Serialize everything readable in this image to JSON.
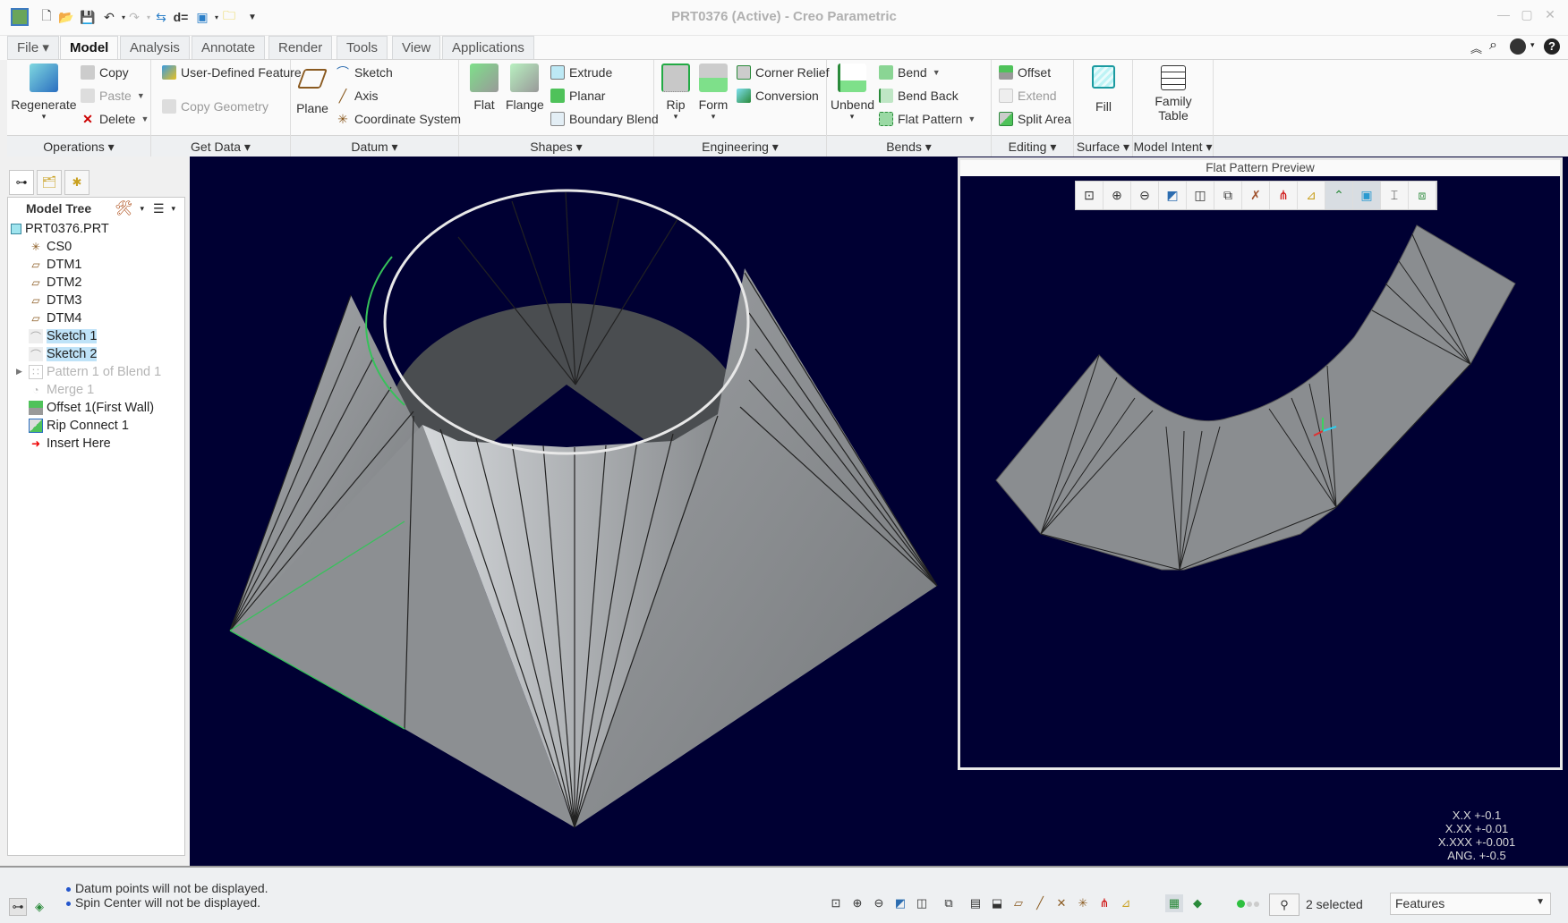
{
  "window": {
    "title": "PRT0376 (Active) - Creo Parametric",
    "minimize": "—",
    "maximize": "▢",
    "close": "✕"
  },
  "quick_access": [
    "app-icon",
    "new-icon",
    "open-icon",
    "save-icon",
    "undo-icon",
    "redo-icon",
    "regenerate-icon",
    "switch-dimensions-icon",
    "windows-icon",
    "close-icon",
    "customize-icon"
  ],
  "tabs": [
    {
      "label": "File ▾"
    },
    {
      "label": "Model"
    },
    {
      "label": "Analysis"
    },
    {
      "label": "Annotate"
    },
    {
      "label": "Render"
    },
    {
      "label": "Tools"
    },
    {
      "label": "View"
    },
    {
      "label": "Applications"
    }
  ],
  "ribbon": {
    "operations": {
      "label": "Operations",
      "regenerate": "Regenerate",
      "copy": "Copy",
      "paste": "Paste",
      "delete": "Delete"
    },
    "get_data": {
      "label": "Get Data",
      "udf": "User-Defined Feature",
      "copy_geometry": "Copy Geometry"
    },
    "datum": {
      "label": "Datum",
      "plane": "Plane",
      "sketch": "Sketch",
      "axis": "Axis",
      "csys": "Coordinate System"
    },
    "shapes": {
      "label": "Shapes",
      "flat": "Flat",
      "flange": "Flange",
      "extrude": "Extrude",
      "planar": "Planar",
      "boundary_blend": "Boundary Blend"
    },
    "engineering": {
      "label": "Engineering",
      "rip": "Rip",
      "form": "Form",
      "corner_relief": "Corner Relief",
      "conversion": "Conversion"
    },
    "bends": {
      "label": "Bends",
      "unbend": "Unbend",
      "bend": "Bend",
      "bend_back": "Bend Back",
      "flat_pattern": "Flat Pattern"
    },
    "editing": {
      "label": "Editing",
      "offset": "Offset",
      "extend": "Extend",
      "split_area": "Split Area"
    },
    "surface": {
      "label": "Surface",
      "fill": "Fill"
    },
    "model_intent": {
      "label": "Model Intent",
      "family_table_1": "Family",
      "family_table_2": "Table"
    }
  },
  "model_tree": {
    "header": "Model Tree",
    "items": [
      {
        "label": "PRT0376.PRT",
        "icon": "part-icon",
        "state": "normal"
      },
      {
        "label": "CS0",
        "icon": "csys-icon",
        "state": "normal"
      },
      {
        "label": "DTM1",
        "icon": "datum-plane-icon",
        "state": "normal"
      },
      {
        "label": "DTM2",
        "icon": "datum-plane-icon",
        "state": "normal"
      },
      {
        "label": "DTM3",
        "icon": "datum-plane-icon",
        "state": "normal"
      },
      {
        "label": "DTM4",
        "icon": "datum-plane-icon",
        "state": "normal"
      },
      {
        "label": "Sketch 1",
        "icon": "sketch-icon",
        "state": "selected"
      },
      {
        "label": "Sketch 2",
        "icon": "sketch-icon",
        "state": "selected"
      },
      {
        "label": "Pattern 1 of Blend 1",
        "icon": "pattern-icon",
        "state": "suppressed"
      },
      {
        "label": "Merge 1",
        "icon": "merge-icon",
        "state": "suppressed"
      },
      {
        "label": "Offset 1(First Wall)",
        "icon": "offset-icon",
        "state": "normal"
      },
      {
        "label": "Rip Connect 1",
        "icon": "rip-icon",
        "state": "normal"
      },
      {
        "label": "Insert Here",
        "icon": "insert-arrow-icon",
        "state": "normal"
      }
    ]
  },
  "preview": {
    "title": "Flat Pattern Preview"
  },
  "tolerances": [
    "X.X +-0.1",
    "X.XX +-0.01",
    "X.XXX +-0.001",
    "ANG. +-0.5"
  ],
  "status": {
    "messages": [
      "Datum points will not be displayed.",
      "Spin Center will not be displayed."
    ],
    "selected": "2 selected",
    "filter": "Features"
  },
  "colors": {
    "graphics_bg": "#000033",
    "selection": "#bfe3f8",
    "model_gray": "#8c8f92"
  }
}
